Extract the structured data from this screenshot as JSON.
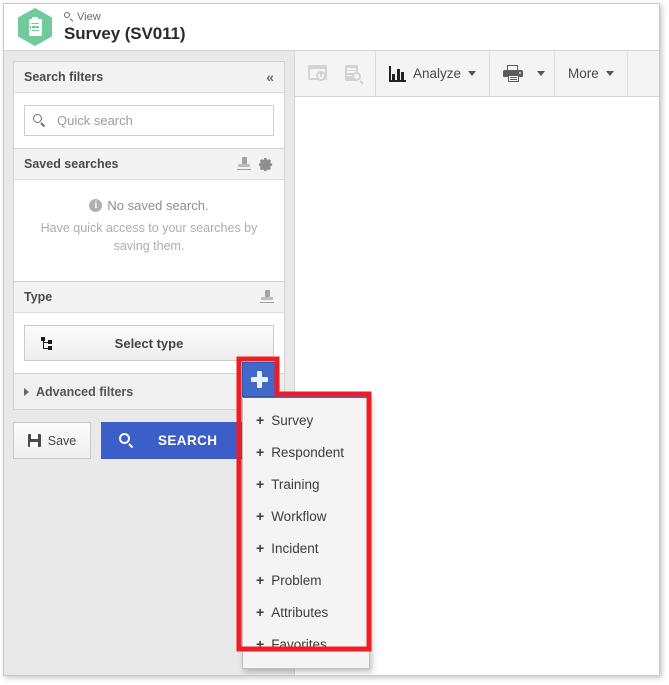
{
  "header": {
    "breadcrumb_icon": "search-icon",
    "breadcrumb": "View",
    "title": "Survey (SV011)",
    "app_icon": "clipboard-hexagon-icon"
  },
  "sidebar": {
    "search_filters_panel": {
      "title": "Search filters",
      "collapse_icon": "double-chevron-left-icon",
      "quick_search_placeholder": "Quick search",
      "quick_search_value": "",
      "search_icon": "search-icon"
    },
    "saved_searches_panel": {
      "title": "Saved searches",
      "eraser_icon": "eraser-icon",
      "gear_icon": "gear-icon",
      "info_icon": "info-icon",
      "empty_title": "No saved search.",
      "empty_hint": "Have quick access to your searches by saving them."
    },
    "type_panel": {
      "title": "Type",
      "eraser_icon": "eraser-icon",
      "select_type_label": "Select type",
      "tree_icon": "tree-hierarchy-icon"
    },
    "advanced_filters": {
      "label": "Advanced filters",
      "expand_icon": "triangle-right-icon",
      "eraser_icon": "eraser-icon"
    },
    "actions": {
      "save_label": "Save",
      "save_icon": "floppy-disk-icon",
      "search_label": "SEARCH",
      "search_icon": "search-icon"
    }
  },
  "toolbar": {
    "items": [
      {
        "name": "history-icon",
        "label": "",
        "icon": "window-clock-icon",
        "disabled": true,
        "caret": false
      },
      {
        "name": "preview-icon",
        "label": "",
        "icon": "document-search-icon",
        "disabled": true,
        "caret": false
      },
      {
        "name": "analyze-button",
        "label": "Analyze",
        "icon": "bar-chart-icon",
        "disabled": false,
        "caret": true
      },
      {
        "name": "print-button",
        "label": "",
        "icon": "printer-icon",
        "disabled": false,
        "caret": true
      },
      {
        "name": "more-button",
        "label": "More",
        "icon": "",
        "disabled": false,
        "caret": true
      }
    ]
  },
  "plus_menu": {
    "button_icon": "plus-icon",
    "items": [
      {
        "prefix": "+",
        "label": "Survey"
      },
      {
        "prefix": "+",
        "label": "Respondent"
      },
      {
        "prefix": "+",
        "label": "Training"
      },
      {
        "prefix": "+",
        "label": "Workflow"
      },
      {
        "prefix": "+",
        "label": "Incident"
      },
      {
        "prefix": "+",
        "label": "Problem"
      },
      {
        "prefix": "+",
        "label": "Attributes"
      },
      {
        "prefix": "+",
        "label": "Favorites"
      }
    ]
  },
  "colors": {
    "accent_blue": "#3c5ec8",
    "plus_blue": "#4169c9",
    "hex_green": "#72c99b",
    "annotation_red": "#ee1c24",
    "panel_bg": "#e9e9e9"
  }
}
